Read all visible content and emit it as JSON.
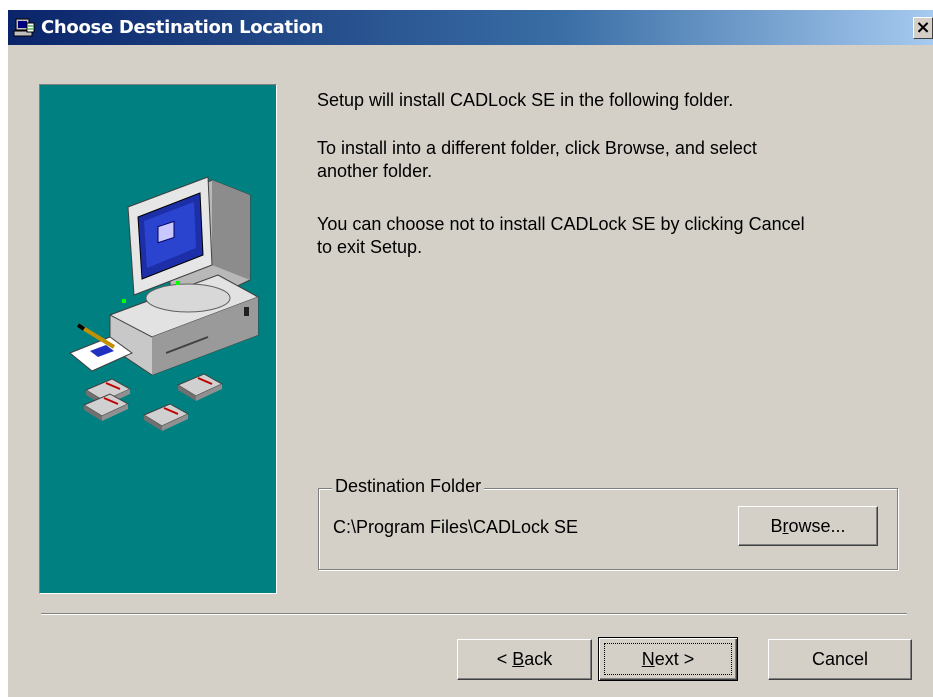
{
  "window": {
    "title": "Choose Destination Location",
    "close_glyph": "×",
    "title_icon": "setup-computer-icon"
  },
  "messages": {
    "line1": "Setup will install CADLock SE in the following folder.",
    "line2a": "To install into a different folder, click Browse, and select",
    "line2b": "another folder.",
    "line3a": "You can choose not to install CADLock SE by clicking Cancel",
    "line3b": "to exit Setup."
  },
  "destination": {
    "group_label": "Destination Folder",
    "path": "C:\\Program Files\\CADLock SE",
    "browse_pre": "B",
    "browse_key": "r",
    "browse_post": "owse..."
  },
  "buttons": {
    "back_pre": "< ",
    "back_key": "B",
    "back_post": "ack",
    "next_key": "N",
    "next_post": "ext >",
    "cancel": "Cancel"
  },
  "colors": {
    "dialog_face": "#d4d0c8",
    "title_gradient_start": "#0a246a",
    "art_background": "#008080"
  }
}
